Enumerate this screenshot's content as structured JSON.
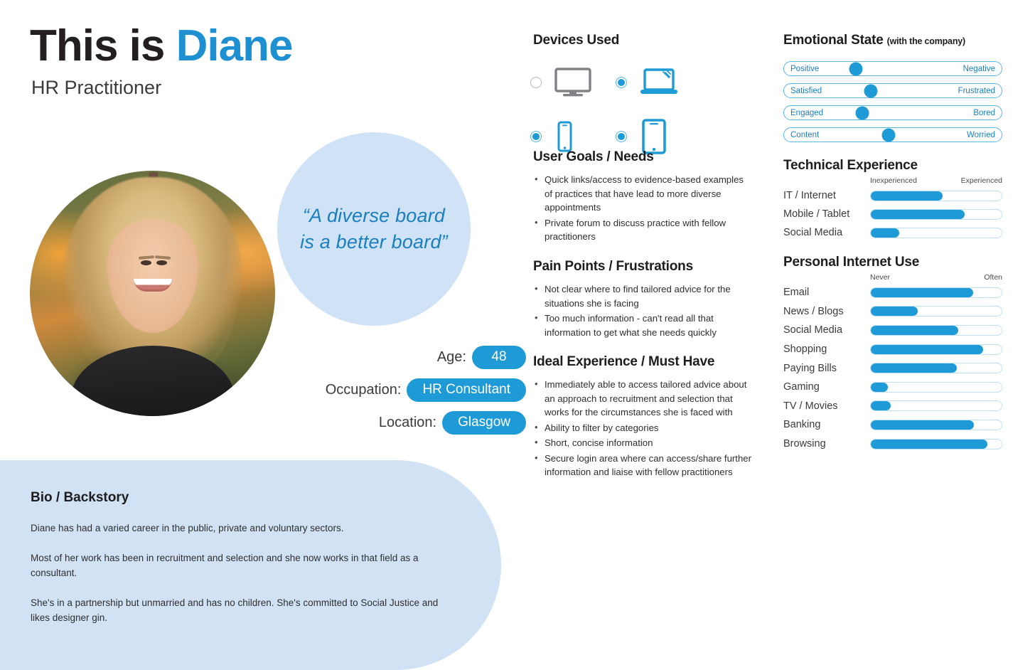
{
  "header": {
    "title_prefix": "This is ",
    "title_name": "Diane",
    "subtitle": "HR Practitioner"
  },
  "quote": "“A diverse board is a better board”",
  "attributes": [
    {
      "label": "Age:",
      "value": "48"
    },
    {
      "label": "Occupation:",
      "value": "HR Consultant"
    },
    {
      "label": "Location:",
      "value": "Glasgow"
    }
  ],
  "bio": {
    "title": "Bio / Backstory",
    "paragraphs": [
      "Diane has had a varied career in the public, private and voluntary sectors.",
      "Most of her work has been in recruitment and selection and she now works in that field as a consultant.",
      "She's in a partnership but unmarried and has no children. She's committed to Social Justice and likes designer gin."
    ]
  },
  "devices": {
    "title": "Devices Used",
    "items": [
      {
        "name": "desktop",
        "selected": false
      },
      {
        "name": "laptop",
        "selected": true
      },
      {
        "name": "phone",
        "selected": true
      },
      {
        "name": "tablet",
        "selected": true
      }
    ]
  },
  "goals": {
    "title": "User Goals / Needs",
    "items": [
      "Quick links/access to evidence-based examples of practices that have lead to more diverse appointments",
      "Private forum to discuss practice with fellow practitioners"
    ]
  },
  "pain_points": {
    "title": "Pain Points / Frustrations",
    "items": [
      "Not clear where to find tailored advice for the situations she is facing",
      "Too much information - can't read all that information to get what she needs quickly"
    ]
  },
  "ideal": {
    "title": "Ideal Experience / Must Have",
    "items": [
      "Immediately able to access tailored advice about an approach to recruitment and selection that works for the circumstances she is faced with",
      "Ability to filter by categories",
      "Short, concise information",
      "Secure login area where can access/share further information and liaise with fellow practitioners"
    ]
  },
  "colors": {
    "accent_blue": "#1e9bd7",
    "title_blue": "#1e90d2",
    "panel_blue": "#d2e2f5",
    "bubble_blue": "#cfe2f6",
    "track_blue": "#bfe0f2",
    "text_dark": "#231f20"
  },
  "chart_data": [
    {
      "type": "bar",
      "title": "Emotional State",
      "subtitle": "(with the company)",
      "orientation": "horizontal-slider",
      "xlabel": "",
      "ylabel": "",
      "xlim": [
        0,
        100
      ],
      "grid": false,
      "legend": "none",
      "categories": [
        "Positive|Negative",
        "Satisfied|Frustrated",
        "Engaged|Bored",
        "Content|Worried"
      ],
      "rows": [
        {
          "left_label": "Positive",
          "right_label": "Negative",
          "value": 33
        },
        {
          "left_label": "Satisfied",
          "right_label": "Frustrated",
          "value": 40
        },
        {
          "left_label": "Engaged",
          "right_label": "Bored",
          "value": 36
        },
        {
          "left_label": "Content",
          "right_label": "Worried",
          "value": 48
        }
      ],
      "values": [
        33,
        40,
        36,
        48
      ]
    },
    {
      "type": "bar",
      "title": "Technical Experience",
      "orientation": "horizontal",
      "scale_low": "Inexperienced",
      "scale_high": "Experienced",
      "xlabel": "",
      "ylabel": "",
      "xlim": [
        0,
        100
      ],
      "grid": false,
      "legend": "none",
      "categories": [
        "IT / Internet",
        "Mobile / Tablet",
        "Social Media"
      ],
      "values": [
        55,
        72,
        22
      ],
      "rows": [
        {
          "label": "IT / Internet",
          "value": 55
        },
        {
          "label": "Mobile / Tablet",
          "value": 72
        },
        {
          "label": "Social Media",
          "value": 22
        }
      ]
    },
    {
      "type": "bar",
      "title": "Personal Internet Use",
      "orientation": "horizontal",
      "scale_low": "Never",
      "scale_high": "Often",
      "xlabel": "",
      "ylabel": "",
      "xlim": [
        0,
        100
      ],
      "grid": false,
      "legend": "none",
      "categories": [
        "Email",
        "News / Blogs",
        "Social Media",
        "Shopping",
        "Paying Bills",
        "Gaming",
        "TV / Movies",
        "Banking",
        "Browsing"
      ],
      "values": [
        78,
        36,
        67,
        86,
        66,
        13,
        15,
        79,
        89
      ],
      "rows": [
        {
          "label": "Email",
          "value": 78
        },
        {
          "label": "News / Blogs",
          "value": 36
        },
        {
          "label": "Social Media",
          "value": 67
        },
        {
          "label": "Shopping",
          "value": 86
        },
        {
          "label": "Paying Bills",
          "value": 66
        },
        {
          "label": "Gaming",
          "value": 13
        },
        {
          "label": "TV / Movies",
          "value": 15
        },
        {
          "label": "Banking",
          "value": 79
        },
        {
          "label": "Browsing",
          "value": 89
        }
      ]
    }
  ]
}
